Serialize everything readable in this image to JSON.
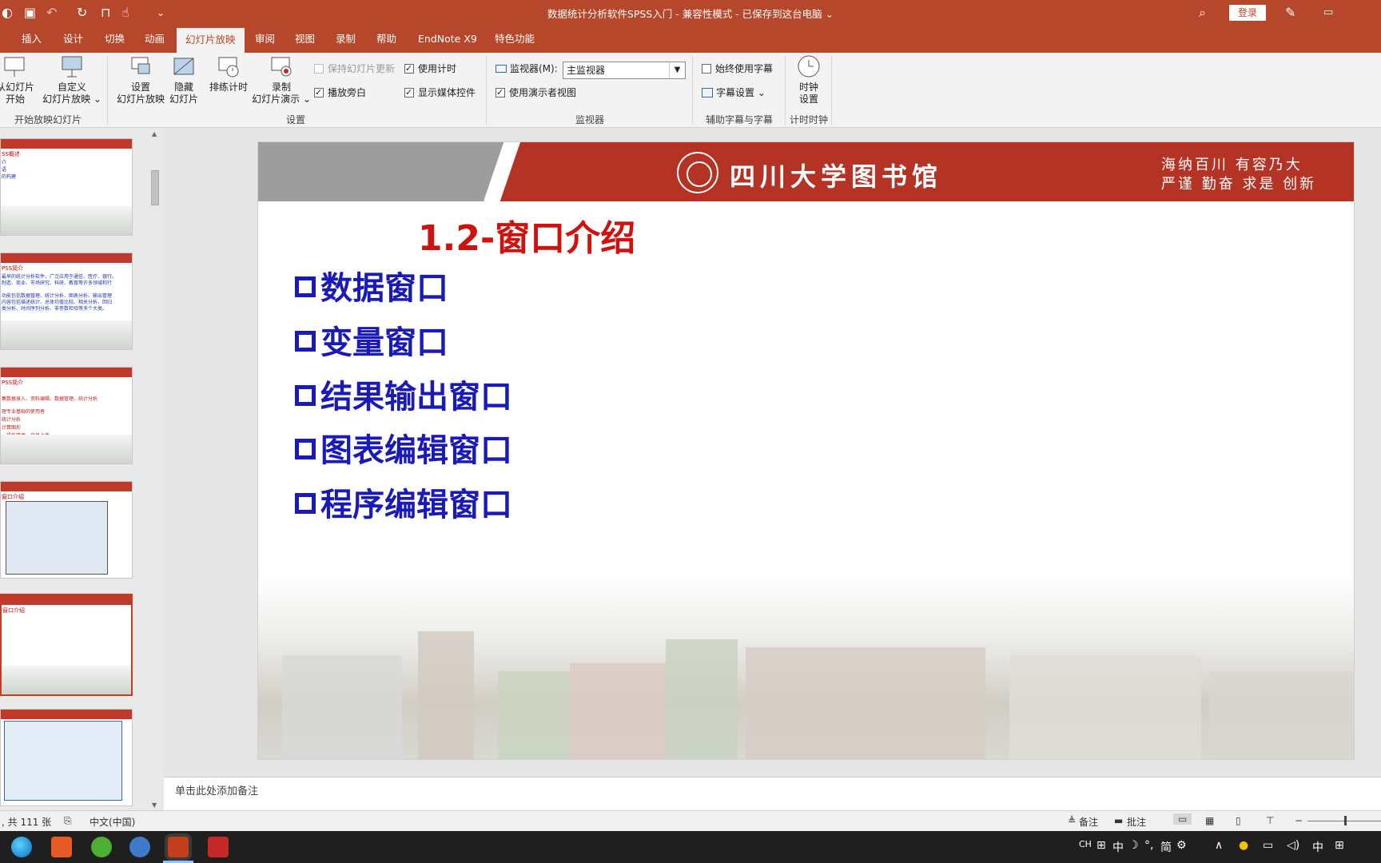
{
  "titlebar": {
    "doc_title": "数据统计分析软件SPSS入门  -  兼容性模式  -  已保存到这台电脑 ⌄",
    "login": "登录"
  },
  "tabs": [
    "插入",
    "设计",
    "切换",
    "动画",
    "幻灯片放映",
    "审阅",
    "视图",
    "录制",
    "帮助",
    "EndNote X9",
    "特色功能"
  ],
  "active_tab": "幻灯片放映",
  "ribbon": {
    "from_start_1": "从幻灯片",
    "from_start_2": "开始",
    "custom_1": "自定义",
    "custom_2": "幻灯片放映 ⌄",
    "group_start": "开始放映幻灯片",
    "setup_1": "设置",
    "setup_2": "幻灯片放映",
    "hide_1": "隐藏",
    "hide_2": "幻灯片",
    "rehearse": "排练计时",
    "record_1": "录制",
    "record_2": "幻灯片演示 ⌄",
    "keep_updated": "保持幻灯片更新",
    "use_timing": "使用计时",
    "play_narration": "播放旁白",
    "show_media": "显示媒体控件",
    "group_setup": "设置",
    "monitor_label": "监视器(M):",
    "monitor_value": "主监视器",
    "presenter_view": "使用演示者视图",
    "group_monitor": "监视器",
    "always_subtitles": "始终使用字幕",
    "subtitle_settings": "字幕设置 ⌄",
    "group_subtitles": "辅助字幕与字幕",
    "timer_1": "时钟",
    "timer_2": "设置",
    "group_timer": "计时时钟"
  },
  "thumbnails": [
    {
      "title": "SS概述",
      "lines": [
        "介",
        "语",
        "的构建"
      ]
    },
    {
      "title": "PSS简介",
      "lines": [
        "最早的统计分析软件，广泛应用于通信、医疗、银行、",
        "制造、商业、市场研究、科研、教育等许多领域和行",
        "功能包括数据管理、统计分析、图表分析、输出管理",
        "内容包括描述统计、总体均值比较、相关分析、回归",
        "类分析、时间序列分析、非参数检验等多个大类。"
      ]
    },
    {
      "title": "PSS简介",
      "lines": [
        "集数据录入、资料编辑、数据管理、统计分析",
        "理专业基础的使用者",
        "统计分析",
        "计算图形",
        "，操作简便，容易上手"
      ]
    },
    {
      "title": "窗口介绍",
      "lines": []
    },
    {
      "title": "窗口介绍",
      "lines": []
    },
    {
      "title": "",
      "lines": []
    }
  ],
  "slide": {
    "library_name": "四川大学图书馆",
    "motto_1": "海纳百川 有容乃大",
    "motto_2": "严谨 勤奋 求是 创新",
    "title": "1.2-窗口介绍",
    "bullets": [
      "数据窗口",
      "变量窗口",
      "结果输出窗口",
      "图表编辑窗口",
      "程序编辑窗口"
    ]
  },
  "notes_placeholder": "单击此处添加备注",
  "statusbar": {
    "slide_count": ", 共 111 张",
    "language": "中文(中国)",
    "notes": "备注",
    "comments": "批注"
  },
  "taskbar": {
    "ime": "中",
    "simplified": "简",
    "lang": "CH"
  },
  "colors": {
    "accent": "#b7472a",
    "slide_title": "#d0120e",
    "bullets": "#1a1ab8"
  }
}
